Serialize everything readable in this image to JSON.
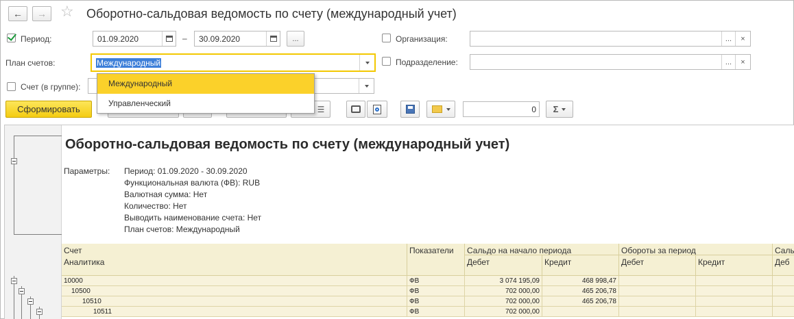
{
  "window": {
    "title": "Оборотно-сальдовая ведомость по счету (международный учет)",
    "nav_back": "←",
    "nav_forward": "→",
    "star": "☆"
  },
  "form": {
    "period_label": "Период:",
    "period_checked": true,
    "date_from": "01.09.2020",
    "date_to": "30.09.2020",
    "date_sep": "–",
    "ellipsis": "...",
    "org_label": "Организация:",
    "org_value": "",
    "dept_label": "Подразделение:",
    "dept_value": "",
    "plan_label": "План счетов:",
    "plan_value": "Международный",
    "account_label": "Счет (в группе):",
    "account_value": "",
    "clear": "×"
  },
  "dropdown": {
    "options": [
      "Международный",
      "Управленческий"
    ],
    "active_index": 0
  },
  "toolbar": {
    "generate_label": "Сформировать",
    "sum_value": "0",
    "sigma": "Σ"
  },
  "report": {
    "title": "Оборотно-сальдовая ведомость по счету (международный учет)",
    "params_label": "Параметры:",
    "params": [
      "Период: 01.09.2020 - 30.09.2020",
      "Функциональная валюта (ФВ): RUB",
      "Валютная сумма: Нет",
      "Количество: Нет",
      "Выводить наименование счета: Нет",
      "План счетов: Международный"
    ],
    "headers": {
      "account": "Счет",
      "analytics": "Аналитика",
      "indicators": "Показатели",
      "opening": "Сальдо на начало периода",
      "turnover": "Обороты за период",
      "closing": "Сальд",
      "debit": "Дебет",
      "credit": "Кредит",
      "debit_cut": "Деб"
    },
    "rows": [
      {
        "account": "10000",
        "indicator": "ФВ",
        "debit": "3 074 195,09",
        "credit": "468 998,47"
      },
      {
        "account": "10500",
        "indicator": "ФВ",
        "debit": "702 000,00",
        "credit": "465 206,78"
      },
      {
        "account": "10510",
        "indicator": "ФВ",
        "debit": "702 000,00",
        "credit": "465 206,78"
      },
      {
        "account": "10511",
        "indicator": "ФВ",
        "debit": "702 000,00",
        "credit": ""
      }
    ]
  }
}
